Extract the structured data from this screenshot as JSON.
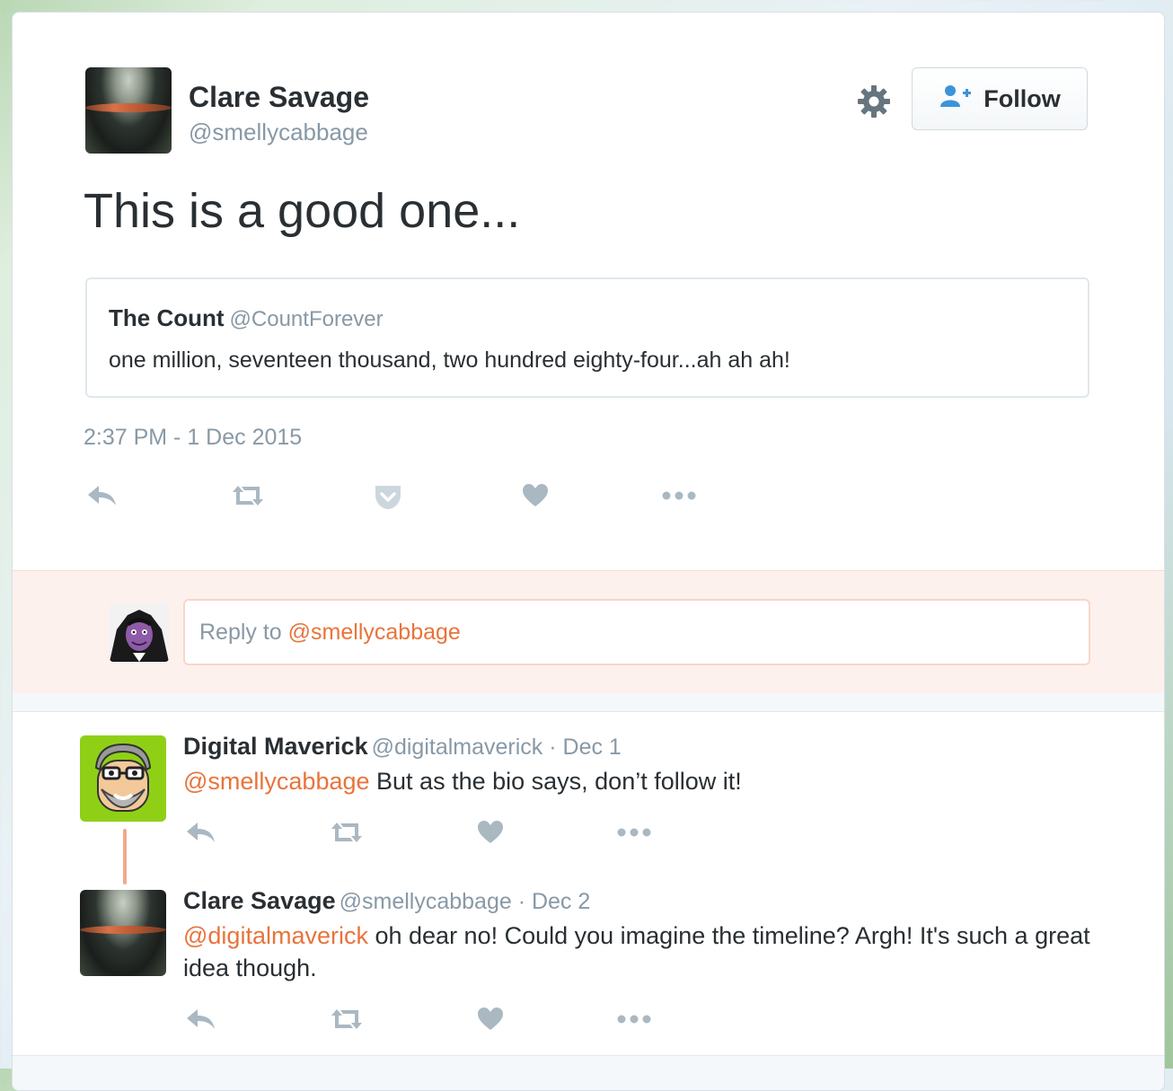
{
  "tweet": {
    "author_name": "Clare Savage",
    "author_handle": "@smellycabbage",
    "follow_label": "Follow",
    "text": "This is a good one...",
    "quote": {
      "name": "The Count",
      "handle": "@CountForever",
      "text": "one million, seventeen thousand, two hundred eighty-four...ah ah ah!"
    },
    "timestamp": "2:37 PM - 1 Dec 2015"
  },
  "reply_box": {
    "prefix": "Reply to",
    "mention": "@smellycabbage"
  },
  "replies": [
    {
      "name": "Digital Maverick",
      "meta": "@digitalmaverick · Dec 1",
      "mention": "@smellycabbage",
      "text": "But as the bio says, don’t follow it!"
    },
    {
      "name": "Clare Savage",
      "meta": "@smellycabbage · Dec 2",
      "mention": "@digitalmaverick",
      "text": "oh dear no! Could you imagine the timeline? Argh! It's such a great idea though."
    }
  ],
  "icons": [
    "gear-icon",
    "add-user-icon",
    "reply-icon",
    "retweet-icon",
    "pocket-icon",
    "heart-icon",
    "more-icon"
  ],
  "colors": {
    "accent": "#e8743b",
    "muted": "#8899a6",
    "icon": "#aab8c2",
    "reply_bg": "#fdf1ed",
    "thread_line": "#f2a98a"
  }
}
